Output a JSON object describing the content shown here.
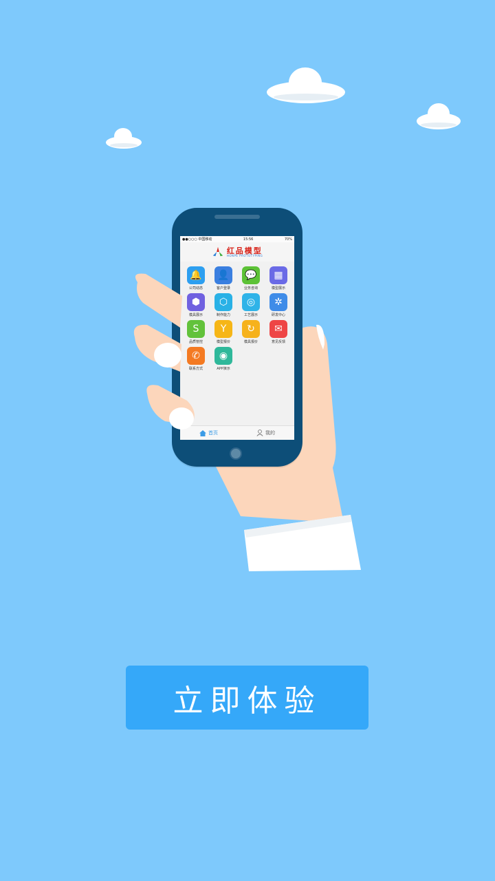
{
  "phone": {
    "status": {
      "carrier": "●●○○○ 中国移动",
      "time": "15:56",
      "battery": "70%"
    },
    "logo": {
      "cn": "红品模型",
      "en": "HONPE PROTOTYPING"
    },
    "apps": [
      {
        "label": "公司动态",
        "color": "#2d9ff0",
        "glyph": "🔔",
        "icon": "bell-icon"
      },
      {
        "label": "客户登录",
        "color": "#3a7fe0",
        "glyph": "👤",
        "icon": "user-icon"
      },
      {
        "label": "业务咨询",
        "color": "#5cc236",
        "glyph": "💬",
        "icon": "chat-icon"
      },
      {
        "label": "模型展示",
        "color": "#6a6ae6",
        "glyph": "▦",
        "icon": "gallery-search-icon"
      },
      {
        "label": "模具展示",
        "color": "#7061e0",
        "glyph": "⬢",
        "icon": "cubes-icon"
      },
      {
        "label": "制作能力",
        "color": "#29b1e6",
        "glyph": "⬡",
        "icon": "hexagon-icon"
      },
      {
        "label": "工艺展示",
        "color": "#2fb3e8",
        "glyph": "◎",
        "icon": "chart-circle-icon"
      },
      {
        "label": "研发中心",
        "color": "#3f8ce8",
        "glyph": "✲",
        "icon": "molecule-icon"
      },
      {
        "label": "品质管控",
        "color": "#62c23b",
        "glyph": "S",
        "icon": "quality-icon"
      },
      {
        "label": "模型报价",
        "color": "#f6b617",
        "glyph": "Y",
        "icon": "price-tree-icon"
      },
      {
        "label": "模具报价",
        "color": "#f6b21c",
        "glyph": "↻",
        "icon": "refresh-icon"
      },
      {
        "label": "意见反馈",
        "color": "#ee4545",
        "glyph": "✉",
        "icon": "feedback-icon"
      },
      {
        "label": "联系方式",
        "color": "#f47a22",
        "glyph": "✆",
        "icon": "phone-icon"
      },
      {
        "label": "APP演示",
        "color": "#2fb89a",
        "glyph": "◉",
        "icon": "eye-icon"
      }
    ],
    "tabs": [
      {
        "label": "首页",
        "icon": "home-icon"
      },
      {
        "label": "我的",
        "icon": "person-icon"
      }
    ]
  },
  "cta": {
    "label": "立即体验"
  }
}
